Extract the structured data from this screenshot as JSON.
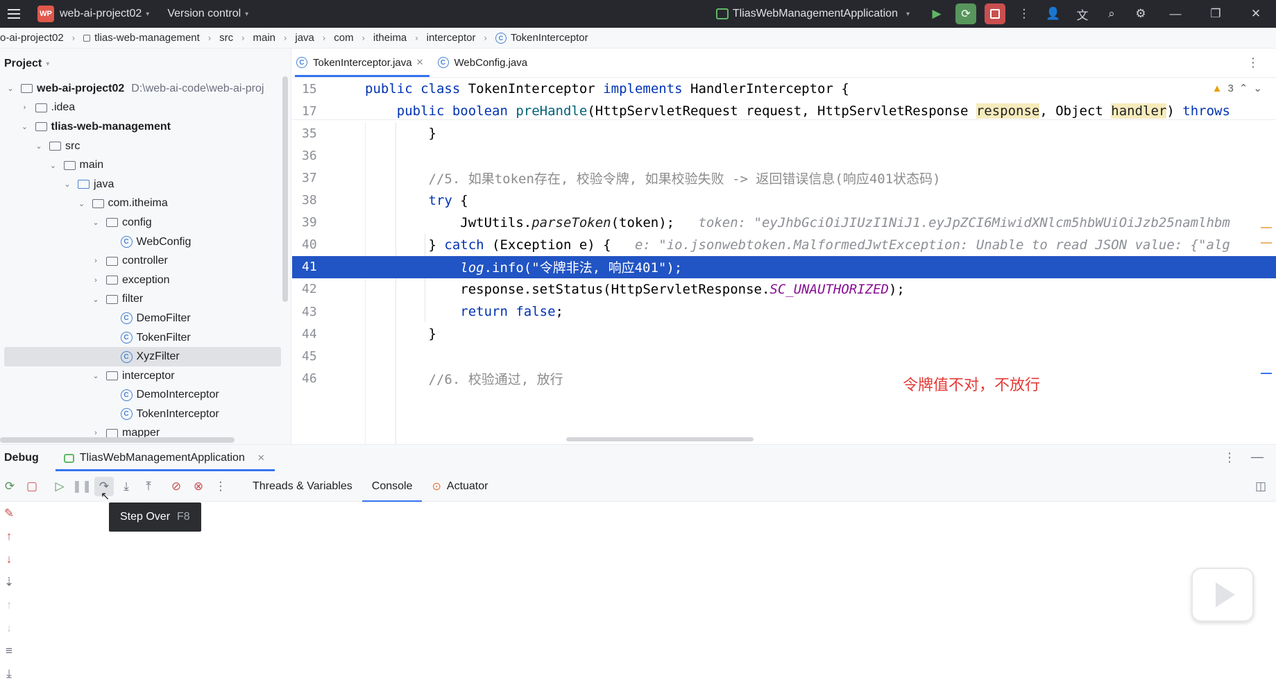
{
  "titlebar": {
    "project": "web-ai-project02",
    "badge": "WP",
    "vcs": "Version control",
    "run_config": "TliasWebManagementApplication"
  },
  "breadcrumb": [
    "o-ai-project02",
    "tlias-web-management",
    "src",
    "main",
    "java",
    "com",
    "itheima",
    "interceptor",
    "TokenInterceptor"
  ],
  "project": {
    "title": "Project",
    "tree": [
      {
        "label": "web-ai-project02",
        "extra": "D:\\web-ai-code\\web-ai-proj",
        "depth": 0,
        "arrow": "v",
        "type": "module",
        "bold": true
      },
      {
        "label": ".idea",
        "depth": 1,
        "arrow": ">",
        "type": "folder"
      },
      {
        "label": "tlias-web-management",
        "depth": 1,
        "arrow": "v",
        "type": "module",
        "bold": true
      },
      {
        "label": "src",
        "depth": 2,
        "arrow": "v",
        "type": "folder"
      },
      {
        "label": "main",
        "depth": 3,
        "arrow": "v",
        "type": "folder"
      },
      {
        "label": "java",
        "depth": 4,
        "arrow": "v",
        "type": "folder-blue"
      },
      {
        "label": "com.itheima",
        "depth": 5,
        "arrow": "v",
        "type": "folder"
      },
      {
        "label": "config",
        "depth": 6,
        "arrow": "v",
        "type": "folder"
      },
      {
        "label": "WebConfig",
        "depth": 7,
        "arrow": "",
        "type": "class"
      },
      {
        "label": "controller",
        "depth": 6,
        "arrow": ">",
        "type": "folder"
      },
      {
        "label": "exception",
        "depth": 6,
        "arrow": ">",
        "type": "folder"
      },
      {
        "label": "filter",
        "depth": 6,
        "arrow": "v",
        "type": "folder"
      },
      {
        "label": "DemoFilter",
        "depth": 7,
        "arrow": "",
        "type": "class"
      },
      {
        "label": "TokenFilter",
        "depth": 7,
        "arrow": "",
        "type": "class"
      },
      {
        "label": "XyzFilter",
        "depth": 7,
        "arrow": "",
        "type": "class",
        "selected": true
      },
      {
        "label": "interceptor",
        "depth": 6,
        "arrow": "v",
        "type": "folder"
      },
      {
        "label": "DemoInterceptor",
        "depth": 7,
        "arrow": "",
        "type": "class"
      },
      {
        "label": "TokenInterceptor",
        "depth": 7,
        "arrow": "",
        "type": "class"
      },
      {
        "label": "mapper",
        "depth": 6,
        "arrow": ">",
        "type": "folder"
      }
    ]
  },
  "editor": {
    "tabs": [
      {
        "label": "TokenInterceptor.java",
        "active": true,
        "close": "✕"
      },
      {
        "label": "WebConfig.java",
        "active": false
      }
    ],
    "warnings": "3",
    "annotation": "令牌值不对，不放行",
    "lines": [
      {
        "n": "15",
        "segments": [
          [
            "kw",
            "public class "
          ],
          [
            "cls",
            "TokenInterceptor "
          ],
          [
            "kw",
            "implements "
          ],
          [
            "cls",
            "HandlerInterceptor {"
          ]
        ]
      },
      {
        "n": "17",
        "segments": [
          [
            "cls",
            "    "
          ],
          [
            "kw",
            "public boolean "
          ],
          [
            "fn",
            "preHandle"
          ],
          [
            "cls",
            "(HttpServletRequest request, HttpServletResponse "
          ],
          [
            "param",
            "response"
          ],
          [
            "cls",
            ", Object "
          ],
          [
            "param",
            "handler"
          ],
          [
            "cls",
            ") "
          ],
          [
            "kw",
            "throws"
          ]
        ]
      },
      {
        "n": "35",
        "segments": [
          [
            "cls",
            "        }"
          ]
        ]
      },
      {
        "n": "36",
        "segments": []
      },
      {
        "n": "37",
        "segments": [
          [
            "cmt",
            "        //5. 如果token存在, 校验令牌, 如果校验失败 -> 返回错误信息(响应401状态码)"
          ]
        ]
      },
      {
        "n": "38",
        "segments": [
          [
            "kw",
            "        try "
          ],
          [
            "cls",
            "{"
          ]
        ]
      },
      {
        "n": "39",
        "segments": [
          [
            "cls",
            "            JwtUtils."
          ],
          [
            "ital",
            "parseToken"
          ],
          [
            "cls",
            "(token);  "
          ],
          [
            "hint",
            " token: \"eyJhbGciOiJIUzI1NiJ1.eyJpZCI6MiwidXNlcm5hbWUiOiJzb25namlhbm"
          ]
        ]
      },
      {
        "n": "40",
        "segments": [
          [
            "cls",
            "        } "
          ],
          [
            "kw",
            "catch "
          ],
          [
            "cls",
            "(Exception e) {  "
          ],
          [
            "hint",
            " e: \"io.jsonwebtoken.MalformedJwtException: Unable to read JSON value: {\"alg"
          ]
        ]
      },
      {
        "n": "41",
        "segments": [
          [
            "cls",
            "            "
          ],
          [
            "ital",
            "log"
          ],
          [
            "cls",
            ".info("
          ],
          [
            "str",
            "\"令牌非法, 响应401\""
          ],
          [
            "cls",
            ");"
          ]
        ],
        "highlight": true
      },
      {
        "n": "42",
        "segments": [
          [
            "cls",
            "            response.setStatus(HttpServletResponse."
          ],
          [
            "const",
            "SC_UNAUTHORIZED"
          ],
          [
            "cls",
            ");"
          ]
        ]
      },
      {
        "n": "43",
        "segments": [
          [
            "kw",
            "            return false"
          ],
          [
            "cls",
            ";"
          ]
        ]
      },
      {
        "n": "44",
        "segments": [
          [
            "cls",
            "        }"
          ]
        ]
      },
      {
        "n": "45",
        "segments": []
      },
      {
        "n": "46",
        "segments": [
          [
            "cmt",
            "        //6. 校验通过, 放行"
          ]
        ]
      }
    ]
  },
  "debug": {
    "title": "Debug",
    "session": "TliasWebManagementApplication",
    "tabs": [
      "Threads & Variables",
      "Console",
      "Actuator"
    ],
    "active_tab": "Console",
    "tooltip_label": "Step Over",
    "tooltip_key": "F8"
  }
}
